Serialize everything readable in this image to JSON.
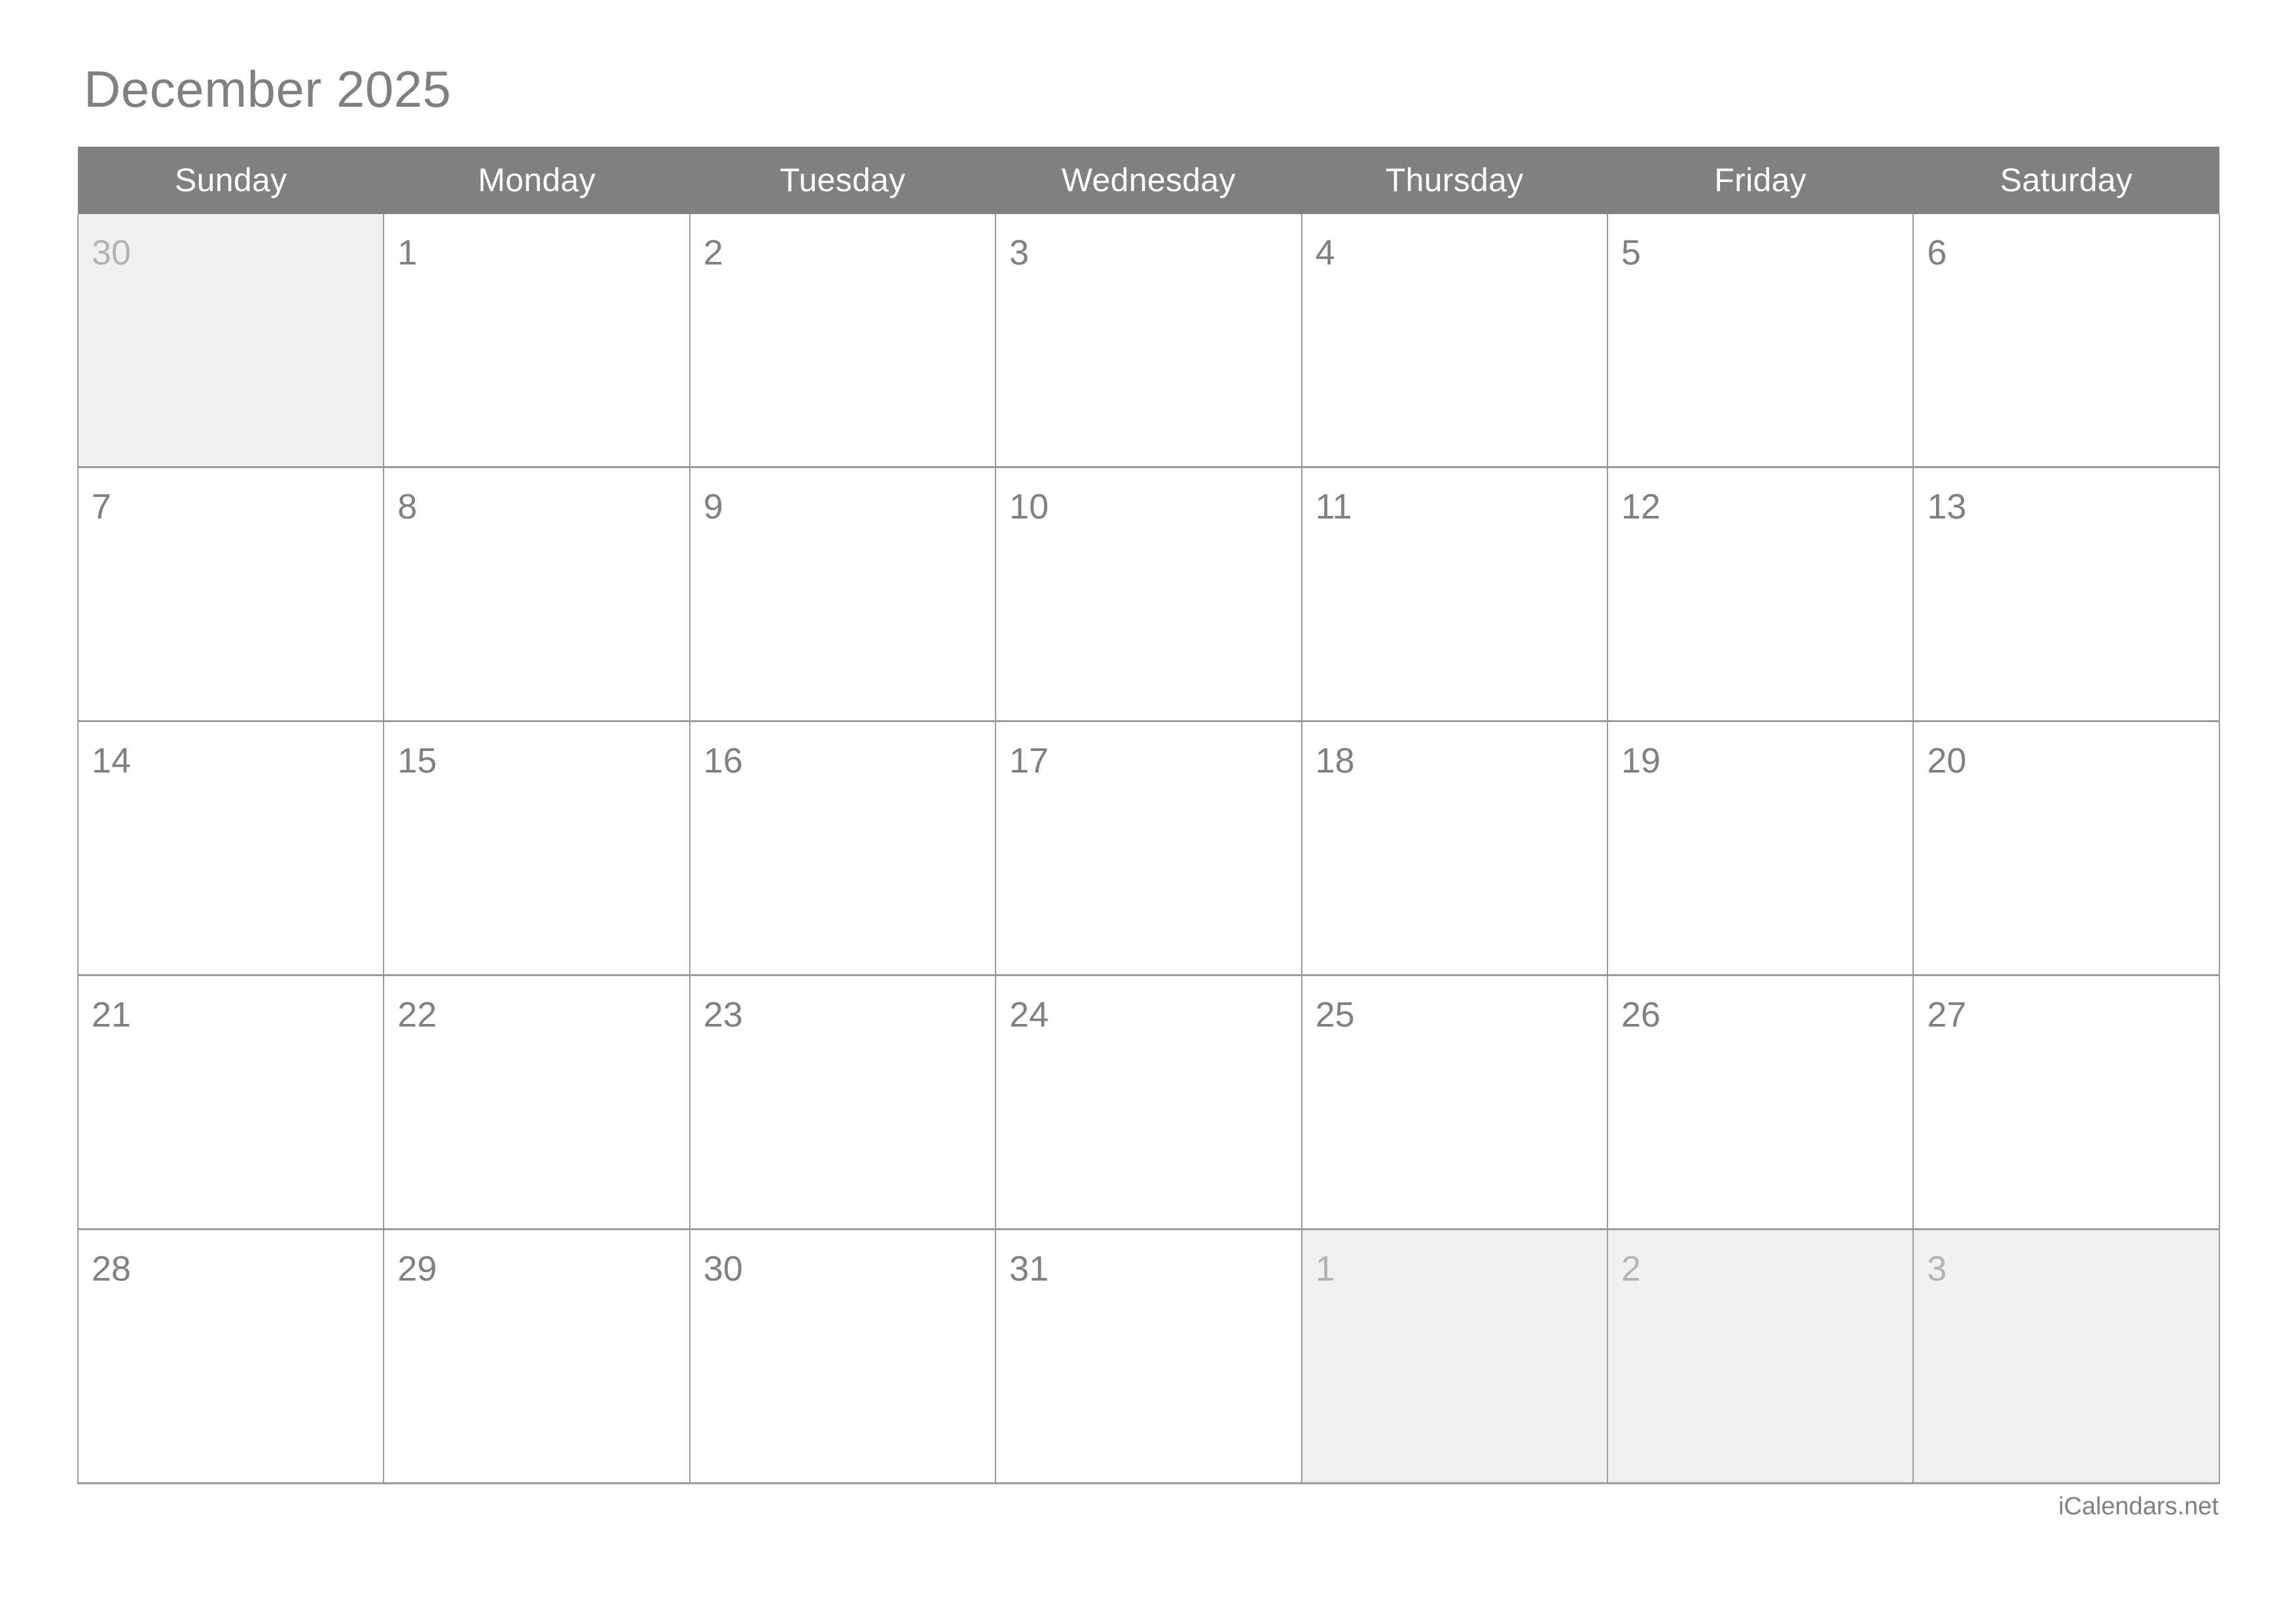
{
  "calendar": {
    "title": "December 2025",
    "month": "December",
    "year": "2025",
    "weekday_headers": [
      "Sunday",
      "Monday",
      "Tuesday",
      "Wednesday",
      "Thursday",
      "Friday",
      "Saturday"
    ],
    "weeks": [
      [
        {
          "day": "30",
          "adjacent": true
        },
        {
          "day": "1",
          "adjacent": false
        },
        {
          "day": "2",
          "adjacent": false
        },
        {
          "day": "3",
          "adjacent": false
        },
        {
          "day": "4",
          "adjacent": false
        },
        {
          "day": "5",
          "adjacent": false
        },
        {
          "day": "6",
          "adjacent": false
        }
      ],
      [
        {
          "day": "7",
          "adjacent": false
        },
        {
          "day": "8",
          "adjacent": false
        },
        {
          "day": "9",
          "adjacent": false
        },
        {
          "day": "10",
          "adjacent": false
        },
        {
          "day": "11",
          "adjacent": false
        },
        {
          "day": "12",
          "adjacent": false
        },
        {
          "day": "13",
          "adjacent": false
        }
      ],
      [
        {
          "day": "14",
          "adjacent": false
        },
        {
          "day": "15",
          "adjacent": false
        },
        {
          "day": "16",
          "adjacent": false
        },
        {
          "day": "17",
          "adjacent": false
        },
        {
          "day": "18",
          "adjacent": false
        },
        {
          "day": "19",
          "adjacent": false
        },
        {
          "day": "20",
          "adjacent": false
        }
      ],
      [
        {
          "day": "21",
          "adjacent": false
        },
        {
          "day": "22",
          "adjacent": false
        },
        {
          "day": "23",
          "adjacent": false
        },
        {
          "day": "24",
          "adjacent": false
        },
        {
          "day": "25",
          "adjacent": false
        },
        {
          "day": "26",
          "adjacent": false
        },
        {
          "day": "27",
          "adjacent": false
        }
      ],
      [
        {
          "day": "28",
          "adjacent": false
        },
        {
          "day": "29",
          "adjacent": false
        },
        {
          "day": "30",
          "adjacent": false
        },
        {
          "day": "31",
          "adjacent": false
        },
        {
          "day": "1",
          "adjacent": true
        },
        {
          "day": "2",
          "adjacent": true
        },
        {
          "day": "3",
          "adjacent": true
        }
      ]
    ]
  },
  "footer": {
    "attribution": "iCalendars.net"
  },
  "colors": {
    "header_background": "#808080",
    "header_text": "#ffffff",
    "title_text": "#808080",
    "day_number": "#808080",
    "adjacent_day_number": "#b3b3b3",
    "adjacent_cell_background": "#f0f0f0",
    "cell_background": "#ffffff",
    "grid_line": "#9a9a9a",
    "page_background": "#ffffff"
  }
}
